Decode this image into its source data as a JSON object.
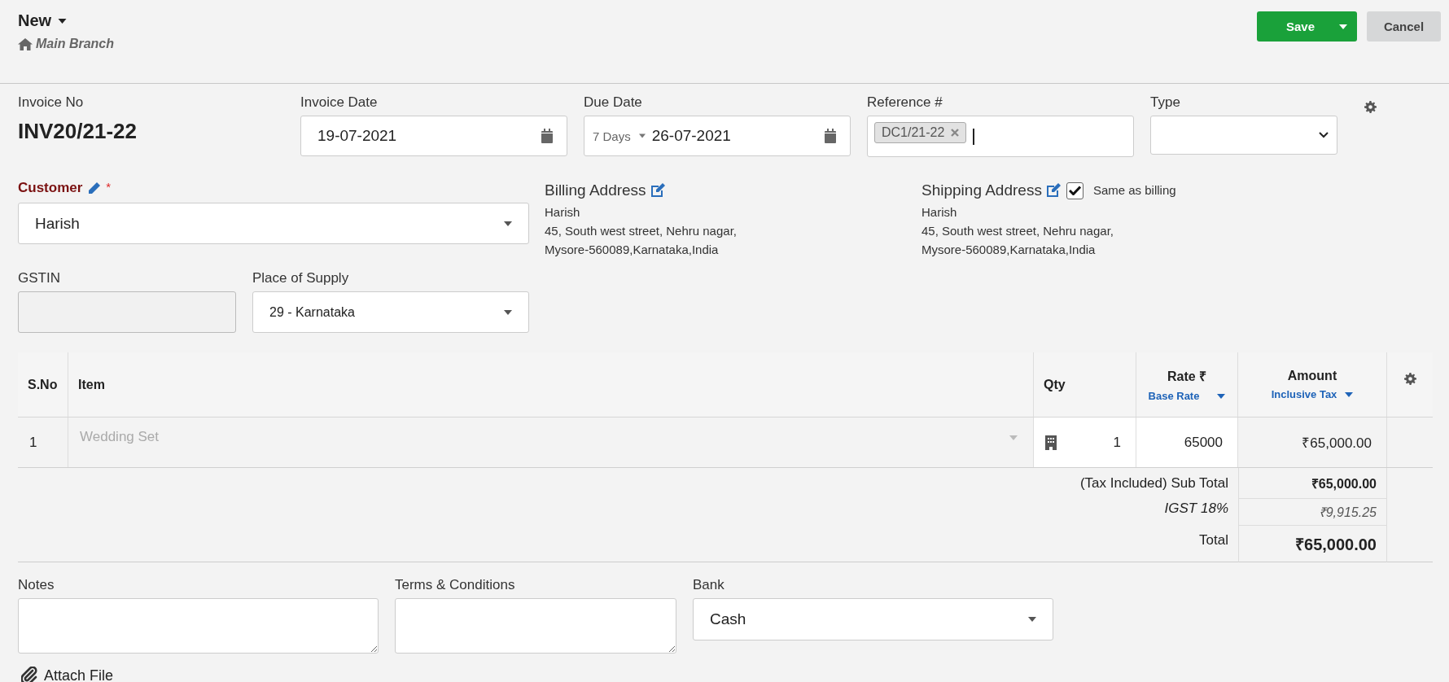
{
  "header": {
    "title": "New",
    "branch": "Main Branch",
    "buttons": [
      {
        "label": "Save",
        "kind": "primary"
      },
      {
        "label": "Cancel",
        "kind": "secondary"
      }
    ]
  },
  "invoice_no": {
    "label": "Invoice No",
    "value": "INV20/21-22"
  },
  "invoice_date": {
    "label": "Invoice Date",
    "value": "19-07-2021"
  },
  "due_date": {
    "label": "Due Date",
    "terms": "7 Days",
    "value": "26-07-2021"
  },
  "reference": {
    "label": "Reference #",
    "tags": [
      "DC1/21-22"
    ]
  },
  "type": {
    "label": "Type"
  },
  "customer": {
    "label": "Customer",
    "required_mark": "*",
    "value": "Harish"
  },
  "billing_address": {
    "title": "Billing Address",
    "lines": [
      "Harish",
      "45, South west street, Nehru nagar,",
      "Mysore-560089,Karnataka,India"
    ]
  },
  "shipping_address": {
    "title": "Shipping Address",
    "same_as_billing": {
      "label": "Same as billing",
      "checked": true
    },
    "lines": [
      "Harish",
      "45, South west street, Nehru nagar,",
      "Mysore-560089,Karnataka,India"
    ]
  },
  "gstin": {
    "label": "GSTIN"
  },
  "place_of_supply": {
    "label": "Place of Supply",
    "value": "29 - Karnataka"
  },
  "table": {
    "columns": [
      {
        "label": "S.No"
      },
      {
        "label": "Item"
      },
      {
        "label": "Qty"
      },
      {
        "label": "Rate ₹",
        "option": "Base Rate"
      },
      {
        "label": "Amount",
        "option": "Inclusive Tax"
      }
    ],
    "rows": [
      {
        "sno": "1",
        "item": "Wedding Set",
        "qty": "1",
        "rate": "65000",
        "amount": "₹65,000.00"
      }
    ]
  },
  "totals": [
    {
      "kind": "subtotal",
      "label": "(Tax Included) Sub Total",
      "value": "₹65,000.00"
    },
    {
      "kind": "tax",
      "label": "IGST 18%",
      "value": "₹9,915.25"
    },
    {
      "kind": "total",
      "label": "Total",
      "value": "₹65,000.00"
    }
  ],
  "notes": {
    "label": "Notes"
  },
  "terms": {
    "label": "Terms & Conditions"
  },
  "bank": {
    "label": "Bank",
    "value": "Cash"
  },
  "attach": {
    "label": "Attach File"
  }
}
